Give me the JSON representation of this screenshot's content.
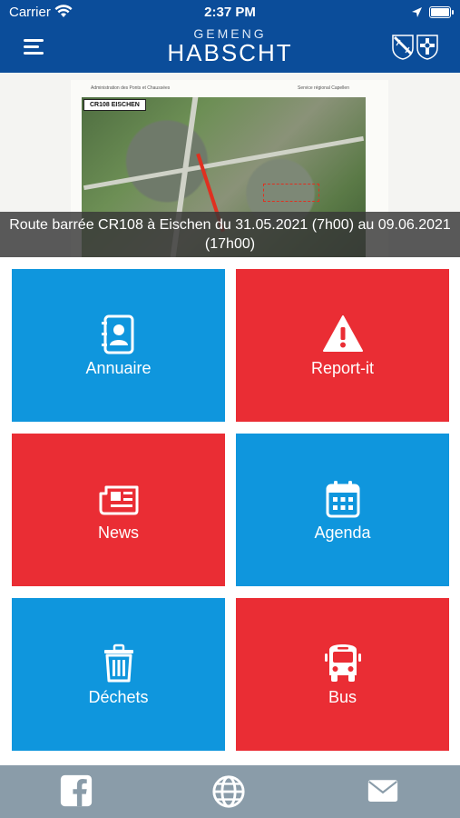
{
  "status_bar": {
    "carrier": "Carrier",
    "time": "2:37 PM"
  },
  "header": {
    "brand_top": "GEMENG",
    "brand_main": "HABSCHT",
    "background_color": "#0b4d9a",
    "menu_icon": "hamburger-menu-icon",
    "crest_icons": [
      "municipal-crest-icon",
      "municipal-crest-icon"
    ]
  },
  "banner": {
    "doc_header_left": "Administration des Ponts et Chaussées",
    "doc_header_right": "Service régional Capellen",
    "map_title": "CR108 EISCHEN",
    "caption": "Route barrée CR108 à Eischen du 31.05.2021 (7h00) au 09.06.2021 (17h00)"
  },
  "tiles": [
    {
      "label": "Annuaire",
      "icon": "address-book-icon",
      "color": "#0f96dd"
    },
    {
      "label": "Report-it",
      "icon": "warning-icon",
      "color": "#ea2d34"
    },
    {
      "label": "News",
      "icon": "newspaper-icon",
      "color": "#ea2d34"
    },
    {
      "label": "Agenda",
      "icon": "calendar-icon",
      "color": "#0f96dd"
    },
    {
      "label": "Déchets",
      "icon": "trash-icon",
      "color": "#0f96dd"
    },
    {
      "label": "Bus",
      "icon": "bus-icon",
      "color": "#ea2d34"
    }
  ],
  "tabbar": {
    "items": [
      "facebook-icon",
      "globe-icon",
      "mail-icon"
    ],
    "background_color": "#8a9ca9"
  }
}
